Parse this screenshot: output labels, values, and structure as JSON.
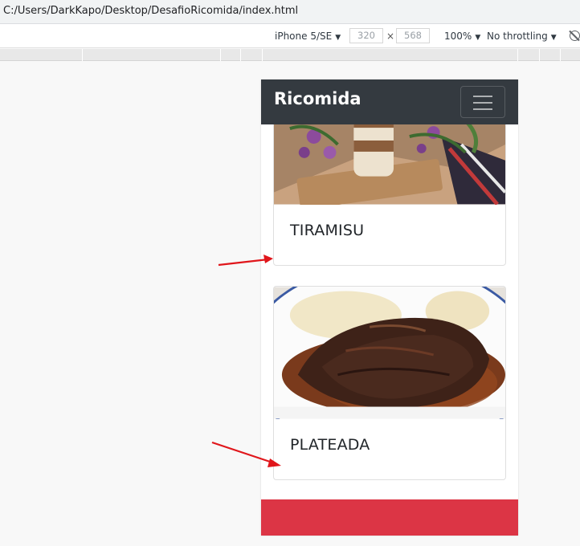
{
  "browser": {
    "address": "C:/Users/DarkKapo/Desktop/DesafioRicomida/index.html"
  },
  "device_toolbar": {
    "device": "iPhone 5/SE",
    "width": "320",
    "height": "568",
    "zoom": "100%",
    "throttling": "No throttling",
    "times": "×"
  },
  "site": {
    "brand": "Ricomida",
    "cards": [
      {
        "title": "TIRAMISU"
      },
      {
        "title": "PLATEADA"
      }
    ]
  },
  "colors": {
    "navbar": "#343a40",
    "footer": "#dc3545",
    "arrow": "#e0161b"
  }
}
